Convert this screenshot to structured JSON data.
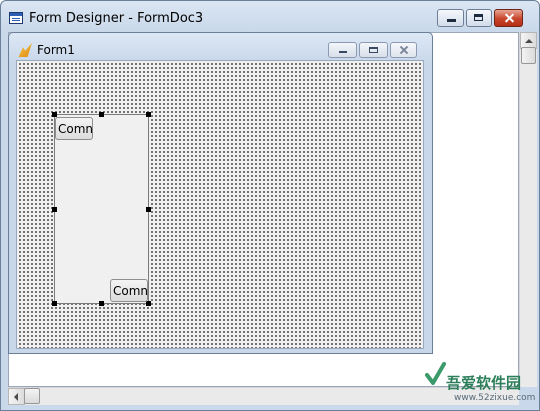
{
  "window": {
    "title": "Form Designer - FormDoc3",
    "icon": "form-designer-icon"
  },
  "child_window": {
    "title": "Form1",
    "icon": "form-icon"
  },
  "controls": [
    {
      "label": "Comn"
    },
    {
      "label": "Comn"
    }
  ],
  "watermark": {
    "name_cn": "吾爱软件园",
    "url": "www.52zixue.com"
  }
}
